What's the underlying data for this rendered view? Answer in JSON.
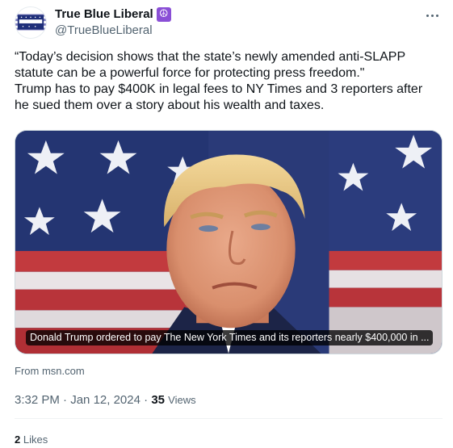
{
  "author": {
    "display_name": "True Blue Liberal",
    "badge_icon": "peace-icon",
    "badge_glyph": "☮",
    "handle": "@TrueBlueLiberal"
  },
  "tweet": {
    "text": "“Today’s decision shows that the state’s newly amended anti-SLAPP\nstatute can be a powerful force for protecting press freedom.\"\nTrump has to pay $400K in legal fees to NY Times and 3 reporters after\nhe sued them over a story about his wealth and taxes."
  },
  "media": {
    "caption": "Donald Trump ordered to pay The New York Times and its reporters nearly $400,000 in ...",
    "source": "From msn.com"
  },
  "meta": {
    "time": "3:32 PM",
    "separator": " · ",
    "date": "Jan 12, 2024",
    "views_separator": " · ",
    "views_count": "35",
    "views_label": "Views"
  },
  "engagement": {
    "likes_count": "2",
    "likes_label": "Likes"
  },
  "colors": {
    "text_primary": "#0f1419",
    "text_secondary": "#536471",
    "badge": "#8a4fd6",
    "divider": "#eff3f4"
  }
}
